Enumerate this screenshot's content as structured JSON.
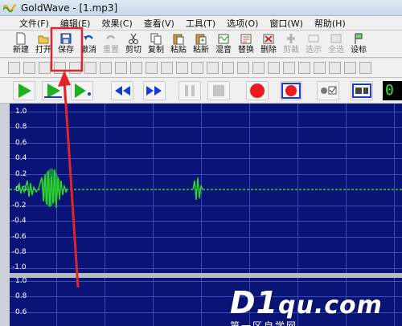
{
  "window": {
    "title": "GoldWave - [1.mp3]"
  },
  "menu": [
    "文件(F)",
    "编辑(E)",
    "效果(C)",
    "查看(V)",
    "工具(T)",
    "选项(O)",
    "窗口(W)",
    "帮助(H)"
  ],
  "toolbar": [
    {
      "label": "新建",
      "icon": "new-file-icon",
      "enabled": true
    },
    {
      "label": "打开",
      "icon": "open-folder-icon",
      "enabled": true
    },
    {
      "label": "保存",
      "icon": "save-disk-icon",
      "enabled": true,
      "highlighted": true
    },
    {
      "label": "撤消",
      "icon": "undo-icon",
      "enabled": true
    },
    {
      "label": "重置",
      "icon": "redo-icon",
      "enabled": false
    },
    {
      "label": "剪切",
      "icon": "scissors-icon",
      "enabled": true
    },
    {
      "label": "复制",
      "icon": "copy-icon",
      "enabled": true
    },
    {
      "label": "粘贴",
      "icon": "paste-icon",
      "enabled": true
    },
    {
      "label": "粘新",
      "icon": "paste-new-icon",
      "enabled": true
    },
    {
      "label": "混音",
      "icon": "mix-icon",
      "enabled": true
    },
    {
      "label": "替换",
      "icon": "replace-icon",
      "enabled": true
    },
    {
      "label": "删除",
      "icon": "delete-icon",
      "enabled": true
    },
    {
      "label": "剪裁",
      "icon": "trim-icon",
      "enabled": false
    },
    {
      "label": "选示",
      "icon": "select-view-icon",
      "enabled": false
    },
    {
      "label": "全选",
      "icon": "select-all-icon",
      "enabled": false
    },
    {
      "label": "设标",
      "icon": "set-marker-icon",
      "enabled": true
    }
  ],
  "transport_counter": "0",
  "waveform": {
    "top_channel_ticks": [
      "1.0",
      "0.8",
      "0.6",
      "0.4",
      "0.2",
      "0.0",
      "-0.2",
      "-0.4",
      "-0.6",
      "-0.8",
      "-1.0"
    ],
    "bottom_channel_ticks": [
      "1.0",
      "0.8",
      "0.6"
    ]
  },
  "watermark": {
    "text_main": "D1",
    "text_small": "qu.com",
    "subtext": "第一区自学网"
  },
  "colors": {
    "wave_bg": "#0a1476",
    "grid": "#3c4bbb",
    "waveform": "#2cd42c",
    "highlight_box": "#e0242a",
    "play_green": "#1fb01f",
    "record_red": "#e81c1c",
    "ff_blue": "#1a3ad2"
  }
}
